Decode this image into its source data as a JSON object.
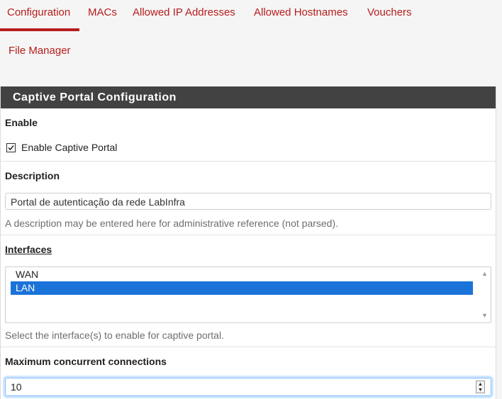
{
  "tabs": [
    {
      "label": "Configuration",
      "active": true
    },
    {
      "label": "MACs",
      "active": false
    },
    {
      "label": "Allowed IP Addresses",
      "active": false
    },
    {
      "label": "Allowed Hostnames",
      "active": false
    },
    {
      "label": "Vouchers",
      "active": false
    },
    {
      "label": "File Manager",
      "active": false
    }
  ],
  "panel": {
    "title": "Captive Portal Configuration"
  },
  "enable": {
    "label": "Enable",
    "checkbox_label": "Enable Captive Portal",
    "checked": true
  },
  "description": {
    "label": "Description",
    "value": "Portal de autenticação da rede LabInfra",
    "help": "A description may be entered here for administrative reference (not parsed)."
  },
  "interfaces": {
    "label": "Interfaces",
    "options": [
      {
        "label": "WAN",
        "selected": false
      },
      {
        "label": "LAN",
        "selected": true
      }
    ],
    "help": "Select the interface(s) to enable for captive portal."
  },
  "max_connections": {
    "label": "Maximum concurrent connections",
    "value": "10"
  },
  "colors": {
    "accent": "#b71c1c",
    "header_bg": "#424242",
    "selection": "#1a73d9"
  }
}
